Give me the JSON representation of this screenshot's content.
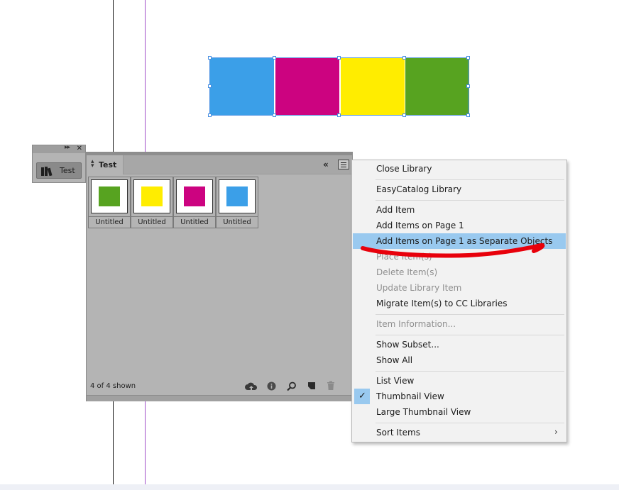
{
  "canvas": {
    "swatches": [
      {
        "color": "#3b9fe8"
      },
      {
        "color": "#cc0380"
      },
      {
        "color": "#ffed00"
      },
      {
        "color": "#57a320"
      }
    ]
  },
  "mini_panel": {
    "button_label": "Test"
  },
  "library_panel": {
    "tab_label": "Test",
    "items": [
      {
        "label": "Untitled",
        "color": "#57a320"
      },
      {
        "label": "Untitled",
        "color": "#ffed00"
      },
      {
        "label": "Untitled",
        "color": "#cc0380"
      },
      {
        "label": "Untitled",
        "color": "#3b9fe8"
      }
    ],
    "status": "4 of 4 shown"
  },
  "context_menu": {
    "items": [
      {
        "label": "Close Library"
      },
      {
        "label": "EasyCatalog Library"
      },
      {
        "label": "Add Item"
      },
      {
        "label": "Add Items on Page 1"
      },
      {
        "label": "Add Items on Page 1 as Separate Objects",
        "highlighted": true
      },
      {
        "label": "Place Item(s)",
        "disabled": true
      },
      {
        "label": "Delete Item(s)",
        "disabled": true
      },
      {
        "label": "Update Library Item",
        "disabled": true
      },
      {
        "label": "Migrate Item(s) to CC Libraries"
      },
      {
        "label": "Item Information...",
        "disabled": true
      },
      {
        "label": "Show Subset..."
      },
      {
        "label": "Show All"
      },
      {
        "label": "List View"
      },
      {
        "label": "Thumbnail View",
        "checked": true
      },
      {
        "label": "Large Thumbnail View"
      },
      {
        "label": "Sort Items",
        "submenu": true
      }
    ]
  },
  "annotation_color": "#e8000b"
}
